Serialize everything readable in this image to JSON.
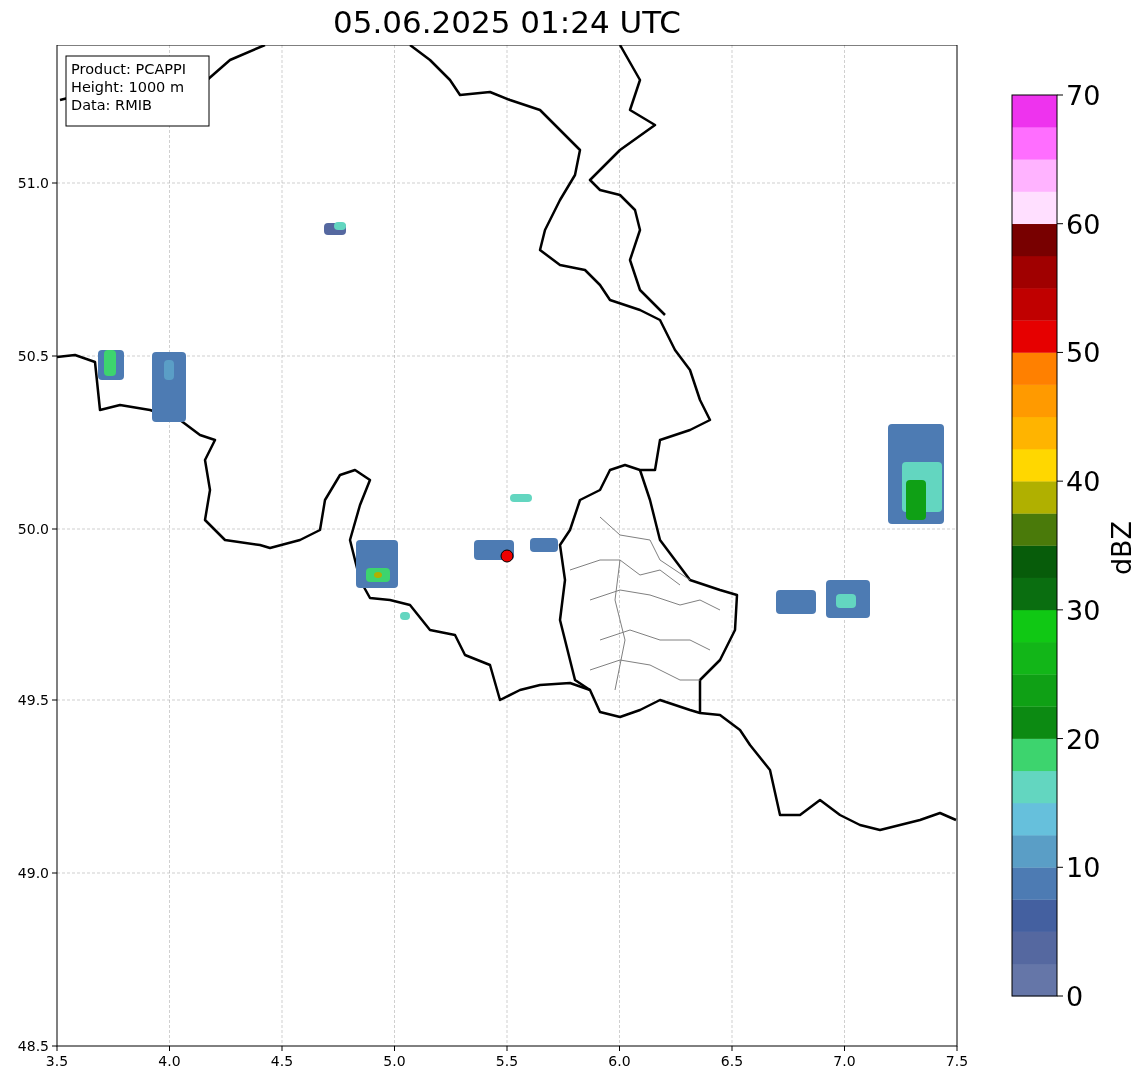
{
  "title": "05.06.2025 01:24 UTC",
  "info_box": [
    "Product: PCAPPI",
    "Height: 1000 m",
    "Data: RMIB"
  ],
  "map": {
    "xticks": [
      "3.5",
      "4.0",
      "4.5",
      "5.0",
      "5.5",
      "6.0",
      "6.5",
      "7.0",
      "7.5"
    ],
    "yticks": [
      "51.0",
      "50.5",
      "50.0",
      "49.5",
      "49.0",
      "48.5"
    ]
  },
  "colorbar": {
    "label": "dBZ",
    "ticks": [
      "70",
      "60",
      "50",
      "40",
      "30",
      "20",
      "10",
      "0"
    ],
    "segments": [
      {
        "color": "#6576a8"
      },
      {
        "color": "#5568a0"
      },
      {
        "color": "#4460a0"
      },
      {
        "color": "#4d7bb3"
      },
      {
        "color": "#5a9ec6"
      },
      {
        "color": "#66c0dc"
      },
      {
        "color": "#63d6c0"
      },
      {
        "color": "#3dd46e"
      },
      {
        "color": "#0c8a12"
      },
      {
        "color": "#0fa015"
      },
      {
        "color": "#12b618"
      },
      {
        "color": "#10c814"
      },
      {
        "color": "#0a6e10"
      },
      {
        "color": "#075c0a"
      },
      {
        "color": "#4a7a0a"
      },
      {
        "color": "#b0b000"
      },
      {
        "color": "#ffd700"
      },
      {
        "color": "#ffb400"
      },
      {
        "color": "#ff9a00"
      },
      {
        "color": "#ff8000"
      },
      {
        "color": "#e60000"
      },
      {
        "color": "#c00000"
      },
      {
        "color": "#a00000"
      },
      {
        "color": "#780000"
      },
      {
        "color": "#ffdfff"
      },
      {
        "color": "#ffb3ff"
      },
      {
        "color": "#ff6eff"
      },
      {
        "color": "#ee33ee"
      }
    ]
  }
}
